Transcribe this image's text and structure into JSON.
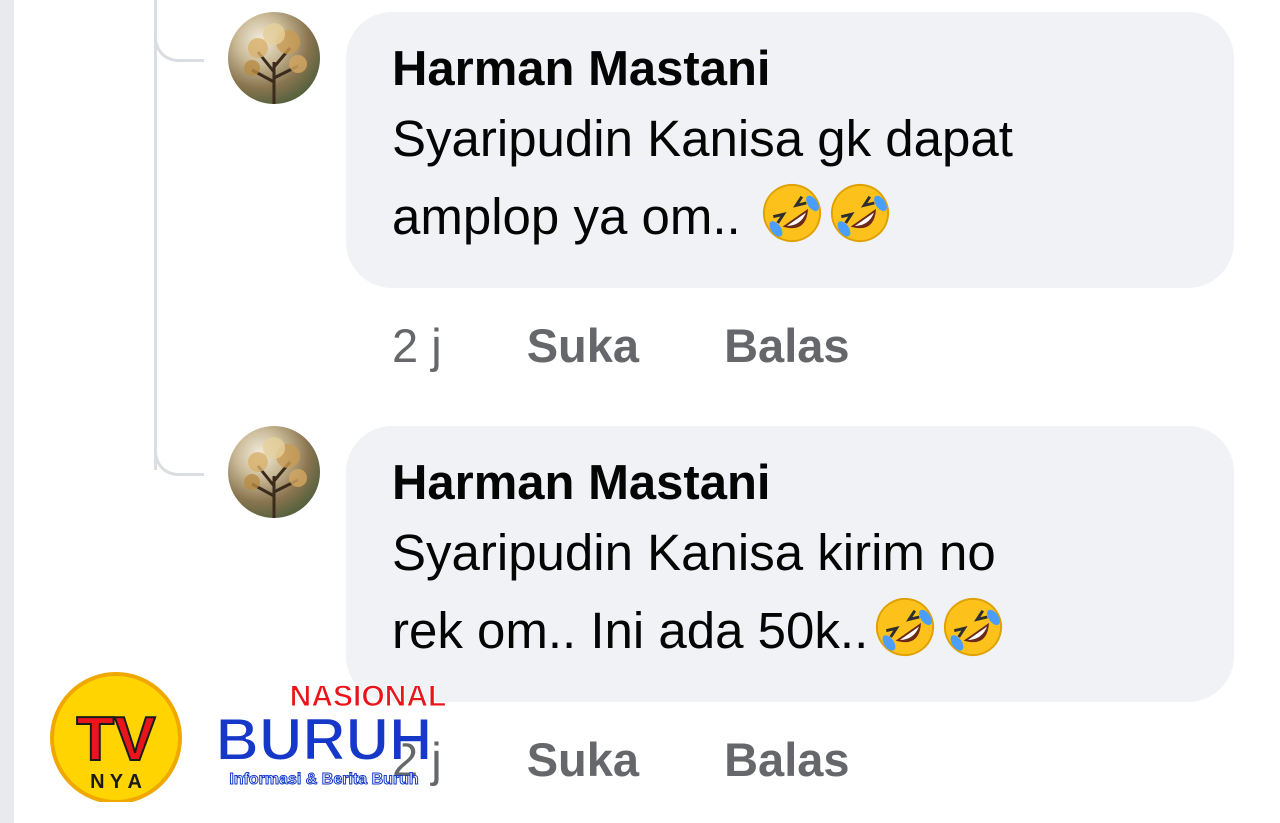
{
  "comments": [
    {
      "author": "Harman Mastani",
      "line1": "Syaripudin Kanisa gk dapat",
      "line2": "amplop ya om..",
      "time": "2 j",
      "like": "Suka",
      "reply": "Balas",
      "emoji": "rolling-on-floor-laughing"
    },
    {
      "author": "Harman Mastani",
      "line1": "Syaripudin Kanisa kirim no",
      "line2": "rek om.. Ini ada 50k..",
      "time": "2 j",
      "like": "Suka",
      "reply": "Balas",
      "emoji": "rolling-on-floor-laughing"
    }
  ],
  "watermark": {
    "top": "NASIONAL",
    "badge": "TV",
    "main": "BURUH",
    "sub": "N Y A",
    "tagline": "Informasi & Berita Buruh"
  },
  "colors": {
    "bubble": "#f0f2f5",
    "meta": "#65676b",
    "text": "#050505",
    "logo_red": "#e8161b",
    "logo_blue": "#1538c9",
    "logo_yellow": "#ffd400"
  }
}
